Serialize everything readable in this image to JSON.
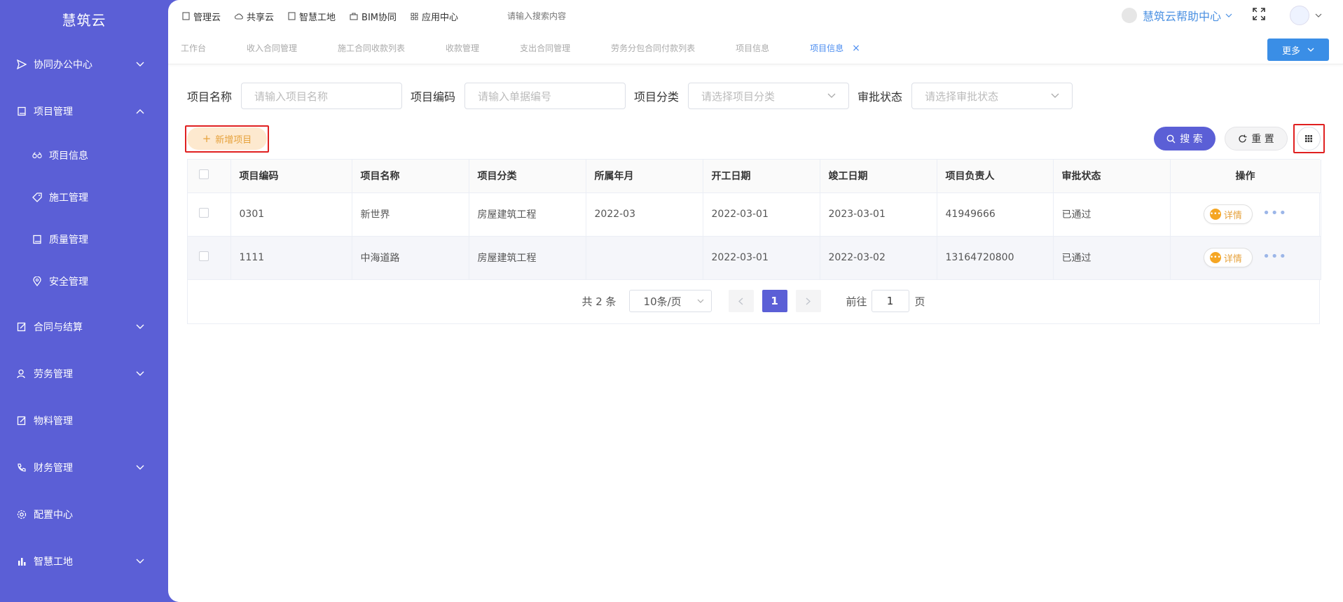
{
  "app": {
    "title": "慧筑云"
  },
  "sidebar": {
    "items": [
      {
        "label": "协同办公中心",
        "icon": "send-icon",
        "expandable": true
      },
      {
        "label": "项目管理",
        "icon": "book-icon",
        "expandable": true,
        "expanded": true
      },
      {
        "label": "项目信息",
        "icon": "glasses-icon",
        "sub": true
      },
      {
        "label": "施工管理",
        "icon": "tag-icon",
        "sub": true
      },
      {
        "label": "质量管理",
        "icon": "book-icon",
        "sub": true
      },
      {
        "label": "安全管理",
        "icon": "location-icon",
        "sub": true
      },
      {
        "label": "合同与结算",
        "icon": "edit-doc-icon",
        "expandable": true
      },
      {
        "label": "劳务管理",
        "icon": "person-icon",
        "expandable": true
      },
      {
        "label": "物料管理",
        "icon": "edit-doc-icon"
      },
      {
        "label": "财务管理",
        "icon": "phone-icon",
        "expandable": true
      },
      {
        "label": "配置中心",
        "icon": "gear-icon"
      },
      {
        "label": "智慧工地",
        "icon": "bar-chart-icon",
        "expandable": true
      }
    ]
  },
  "topbar": {
    "nav": [
      "管理云",
      "共享云",
      "智慧工地",
      "BIM协同",
      "应用中心"
    ],
    "search_placeholder": "请输入搜索内容",
    "help_label": "慧筑云帮助中心"
  },
  "tabs": {
    "items": [
      "工作台",
      "收入合同管理",
      "施工合同收款列表",
      "收款管理",
      "支出合同管理",
      "劳务分包合同付款列表",
      "项目信息",
      "项目信息"
    ],
    "active_index": 7,
    "more_label": "更多"
  },
  "filters": {
    "name_label": "项目名称",
    "name_placeholder": "请输入项目名称",
    "code_label": "项目编码",
    "code_placeholder": "请输入单据编号",
    "category_label": "项目分类",
    "category_placeholder": "请选择项目分类",
    "status_label": "审批状态",
    "status_placeholder": "请选择审批状态"
  },
  "actions": {
    "add_label": "新增项目",
    "search_label": "搜 索",
    "reset_label": "重 置"
  },
  "table": {
    "columns": [
      "项目编码",
      "项目名称",
      "项目分类",
      "所属年月",
      "开工日期",
      "竣工日期",
      "项目负责人",
      "审批状态",
      "操作"
    ],
    "rows": [
      [
        "0301",
        "新世界",
        "房屋建筑工程",
        "2022-03",
        "2022-03-01",
        "2023-03-01",
        "41949666",
        "已通过"
      ],
      [
        "1111",
        "中海道路",
        "房屋建筑工程",
        "",
        "2022-03-01",
        "2022-03-02",
        "13164720800",
        "已通过"
      ]
    ],
    "detail_label": "详情",
    "more_dots": "•••"
  },
  "pagination": {
    "total_label": "共 2 条",
    "page_size": "10条/页",
    "current_page": "1",
    "goto_prefix": "前往",
    "goto_value": "1",
    "goto_suffix": "页"
  },
  "colors": {
    "sidebar_bg": "#5b5fd6",
    "accent": "#5b5fd6",
    "tab_active": "#4a8cf0",
    "add_button": "#e6a23c"
  }
}
